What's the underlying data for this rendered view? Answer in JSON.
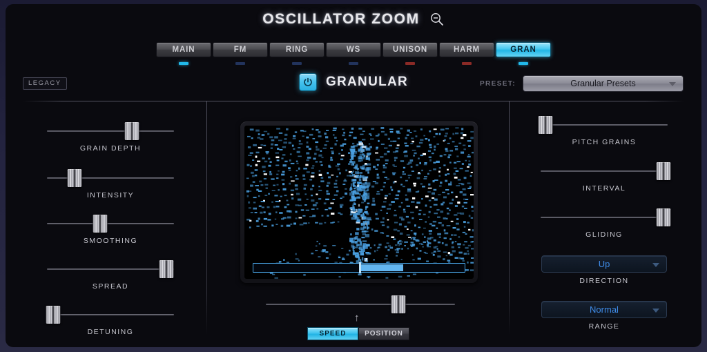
{
  "window": {
    "title": "OSCILLATOR ZOOM",
    "zoom_icon": "magnifier-minus-icon"
  },
  "tabs": [
    {
      "label": "MAIN",
      "active": false,
      "indicator": "#22b9ea"
    },
    {
      "label": "FM",
      "active": false,
      "indicator": "#22335c"
    },
    {
      "label": "RING",
      "active": false,
      "indicator": "#22335c"
    },
    {
      "label": "WS",
      "active": false,
      "indicator": "#22335c"
    },
    {
      "label": "UNISON",
      "active": false,
      "indicator": "#8a2a26"
    },
    {
      "label": "HARM",
      "active": false,
      "indicator": "#8a2a26"
    },
    {
      "label": "GRAN",
      "active": true,
      "indicator": "#22b9ea"
    }
  ],
  "header": {
    "legacy_label": "LEGACY",
    "power_icon": "power-icon",
    "power_on": true,
    "module_name": "GRANULAR",
    "preset_label": "PRESET:",
    "preset_value": "Granular Presets",
    "preset_caret_icon": "chevron-down-icon"
  },
  "left_sliders": [
    {
      "label": "GRAIN DEPTH",
      "value": 67
    },
    {
      "label": "INTENSITY",
      "value": 22
    },
    {
      "label": "SMOOTHING",
      "value": 42
    },
    {
      "label": "SPREAD",
      "value": 94
    },
    {
      "label": "DETUNING",
      "value": 5
    }
  ],
  "right_sliders": [
    {
      "label": "PITCH GRAINS",
      "value": 4
    },
    {
      "label": "INTERVAL",
      "value": 97
    },
    {
      "label": "GLIDING",
      "value": 97
    }
  ],
  "right_dropdowns": [
    {
      "label": "DIRECTION",
      "value": "Up",
      "caret_icon": "chevron-down-icon"
    },
    {
      "label": "RANGE",
      "value": "Normal",
      "caret_icon": "chevron-down-icon"
    }
  ],
  "center": {
    "visualizer_name": "grain-cloud-display",
    "progress_start": 50,
    "progress_end": 71,
    "playhead": 50,
    "rate_slider_value": 70,
    "arrow_icon": "arrow-up-icon",
    "mode_speed": "SPEED",
    "mode_position": "POSITION",
    "mode_active": "SPEED"
  },
  "colors": {
    "accent": "#45c8f0",
    "dropdown_text": "#3f8ce8",
    "panel_bg": "#0a0a0f",
    "frame": "#23233f",
    "grain_blue": "#4a9fe0"
  }
}
